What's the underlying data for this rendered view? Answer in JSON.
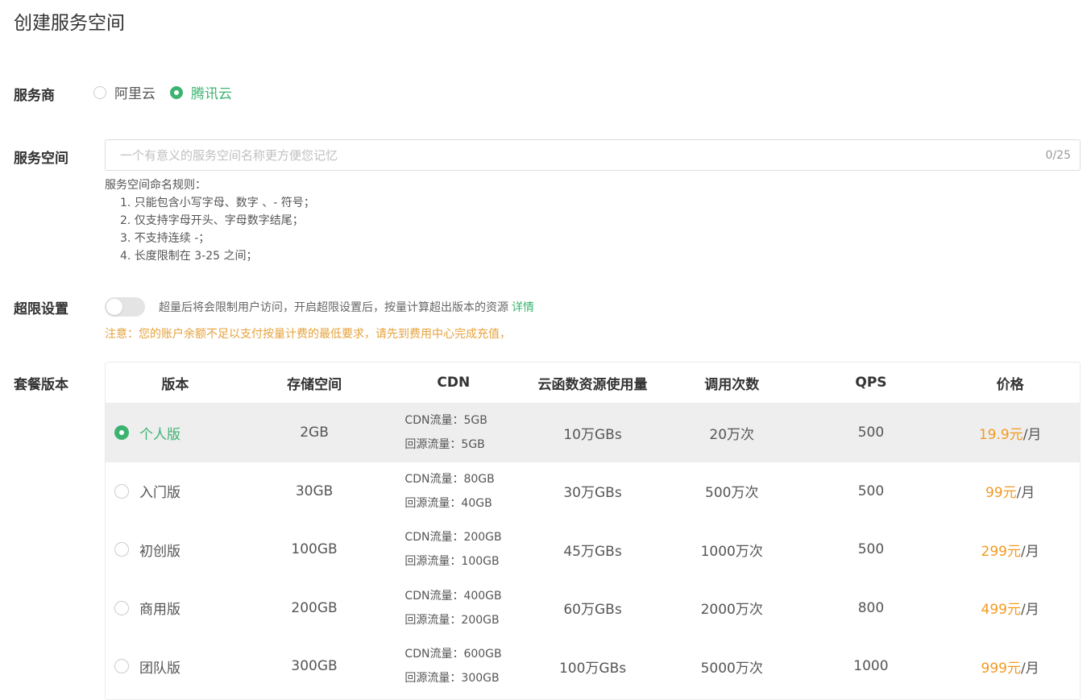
{
  "page": {
    "title": "创建服务空间"
  },
  "provider": {
    "label": "服务商",
    "options": [
      {
        "label": "阿里云",
        "checked": false
      },
      {
        "label": "腾讯云",
        "checked": true
      }
    ]
  },
  "space": {
    "label": "服务空间",
    "placeholder": "一个有意义的服务空间名称更方便您记忆",
    "value": "",
    "counter": "0/25",
    "rules_title": "服务空间命名规则：",
    "rules": [
      "1. 只能包含小写字母、数字 、- 符号；",
      "2. 仅支持字母开头、字母数字结尾；",
      "3. 不支持连续 -；",
      "4. 长度限制在 3-25 之间；"
    ]
  },
  "overlimit": {
    "label": "超限设置",
    "enabled": false,
    "description": "超量后将会限制用户访问，开启超限设置后，按量计算超出版本的资源",
    "link": "详情",
    "notice": "注意：您的账户余额不足以支付按量计费的最低要求，请先到费用中心完成充值，"
  },
  "plans": {
    "label": "套餐版本",
    "headers": [
      "版本",
      "存储空间",
      "CDN",
      "云函数资源使用量",
      "调用次数",
      "QPS",
      "价格"
    ],
    "rows": [
      {
        "name": "个人版",
        "checked": true,
        "storage": "2GB",
        "cdn": "CDN流量：5GB",
        "origin": "回源流量：5GB",
        "fn": "10万GBs",
        "calls": "20万次",
        "qps": "500",
        "price": "19.9元",
        "unit": "/月"
      },
      {
        "name": "入门版",
        "checked": false,
        "storage": "30GB",
        "cdn": "CDN流量：80GB",
        "origin": "回源流量：40GB",
        "fn": "30万GBs",
        "calls": "500万次",
        "qps": "500",
        "price": "99元",
        "unit": "/月"
      },
      {
        "name": "初创版",
        "checked": false,
        "storage": "100GB",
        "cdn": "CDN流量：200GB",
        "origin": "回源流量：100GB",
        "fn": "45万GBs",
        "calls": "1000万次",
        "qps": "500",
        "price": "299元",
        "unit": "/月"
      },
      {
        "name": "商用版",
        "checked": false,
        "storage": "200GB",
        "cdn": "CDN流量：400GB",
        "origin": "回源流量：200GB",
        "fn": "60万GBs",
        "calls": "2000万次",
        "qps": "800",
        "price": "499元",
        "unit": "/月"
      },
      {
        "name": "团队版",
        "checked": false,
        "storage": "300GB",
        "cdn": "CDN流量：600GB",
        "origin": "回源流量：300GB",
        "fn": "100万GBs",
        "calls": "5000万次",
        "qps": "1000",
        "price": "999元",
        "unit": "/月"
      }
    ]
  },
  "colors": {
    "accent": "#3cb371",
    "price": "#f29b20",
    "notice": "#e6a23c"
  }
}
